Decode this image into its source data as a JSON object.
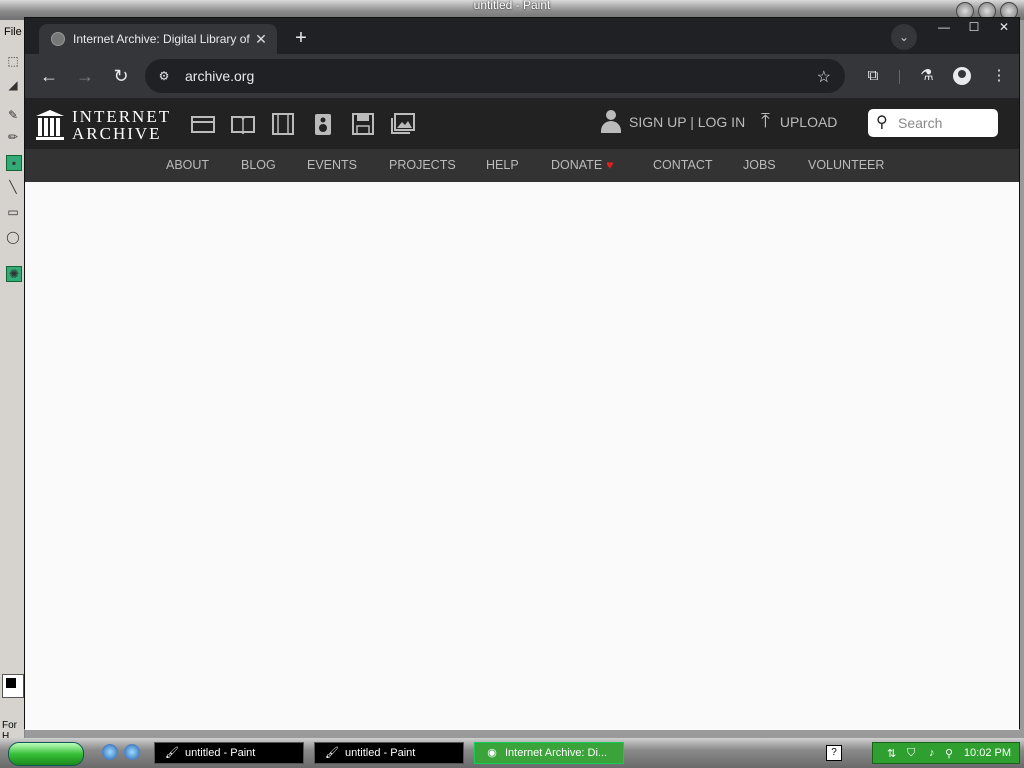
{
  "paint": {
    "title": "untitled - Paint",
    "menu_file": "File",
    "status": "For H"
  },
  "browser": {
    "tab_title": "Internet Archive: Digital Library of",
    "tab_close": "✕",
    "new_tab": "+",
    "tab_search_icon": "chevron-down-icon",
    "win_min": "—",
    "win_max": "☐",
    "win_close": "✕",
    "back": "←",
    "forward": "→",
    "reload": "↻",
    "url": "archive.org",
    "star": "☆",
    "extensions": "⧉",
    "labs": "⚗",
    "menu": "⋮"
  },
  "ia": {
    "logo_line1": "INTERNET",
    "logo_line2": "ARCHIVE",
    "signup": "SIGN UP | LOG IN",
    "upload": "UPLOAD",
    "search_placeholder": "Search",
    "nav": [
      "ABOUT",
      "BLOG",
      "EVENTS",
      "PROJECTS",
      "HELP",
      "DONATE",
      "CONTACT",
      "JOBS",
      "VOLUNTEER"
    ],
    "heart_color": "#e02020"
  },
  "taskbar": {
    "tasks": [
      "untitled - Paint",
      "untitled - Paint",
      "Internet Archive: Di..."
    ],
    "clock": "10:02 PM",
    "help": "?"
  }
}
